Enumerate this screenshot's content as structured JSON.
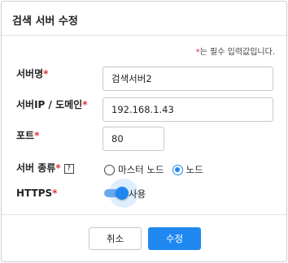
{
  "dialog": {
    "title": "검색 서버 수정",
    "required_note_star": "*",
    "required_note_text": "는 필수 입력값입니다."
  },
  "fields": {
    "server_name": {
      "label": "서버명",
      "star": "*",
      "value": "검색서버2"
    },
    "server_ip": {
      "label": "서버IP / 도메인",
      "star": "*",
      "value": "192.168.1.43"
    },
    "port": {
      "label": "포트",
      "star": "*",
      "value": "80"
    },
    "server_type": {
      "label": "서버 종류",
      "star": "*",
      "help": "?",
      "options": [
        {
          "label": "마스터 노드",
          "checked": false
        },
        {
          "label": "노드",
          "checked": true
        }
      ]
    },
    "https": {
      "label": "HTTPS",
      "star": "*",
      "toggle_label": "사용",
      "enabled": true
    }
  },
  "buttons": {
    "cancel": "취소",
    "submit": "수정"
  },
  "colors": {
    "accent": "#1e88f0",
    "required": "#e0303a"
  }
}
